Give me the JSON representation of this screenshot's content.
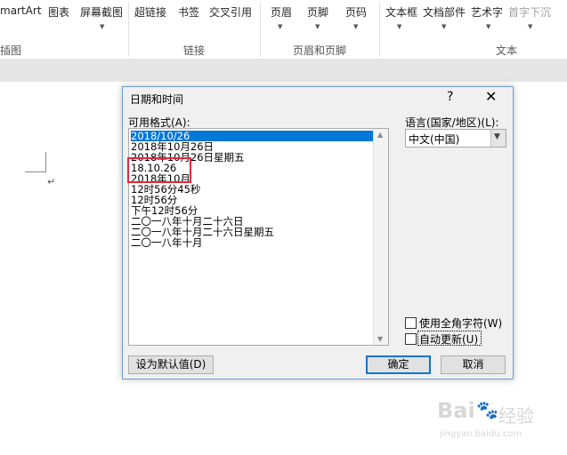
{
  "ribbon": {
    "buttons": {
      "smartart": "martArt",
      "chart": "图表",
      "screenshot": "屏幕截图",
      "hyperlink": "超链接",
      "bookmark": "书签",
      "cross_reference": "交叉引用",
      "header": "页眉",
      "footer": "页脚",
      "page_number": "页码",
      "text_box": "文本框",
      "quick_parts": "文档部件",
      "wordart": "艺术字",
      "drop_cap": "首字下沉"
    },
    "groups": {
      "illustrations": "插图",
      "links": "链接",
      "header_footer": "页眉和页脚",
      "text": "文本"
    }
  },
  "dialog": {
    "title": "日期和时间",
    "help": "?",
    "close": "✕",
    "available_formats_label": "可用格式(A):",
    "formats": [
      "2018/10/26",
      "2018年10月26日",
      "2018年10月26日星期五",
      "18.10.26",
      "2018年10月",
      "12时56分45秒",
      "12时56分",
      "下午12时56分",
      "二〇一八年十月二十六日",
      "二〇一八年十月二十六日星期五",
      "二〇一八年十月"
    ],
    "selected_index": 0,
    "language_label": "语言(国家/地区)(L):",
    "language_value": "中文(中国)",
    "use_full_width_label": "使用全角字符(W)",
    "auto_update_label": "自动更新(U)",
    "set_default_button": "设为默认值(D)",
    "ok_button": "确定",
    "cancel_button": "取消"
  },
  "watermark": {
    "brand": "Bai",
    "brand2": "经验",
    "url": "jingyan.baidu.com"
  },
  "colors": {
    "selection": "#0078d7",
    "highlight_box": "#e0293a",
    "dialog_border": "#6f9bd1"
  }
}
